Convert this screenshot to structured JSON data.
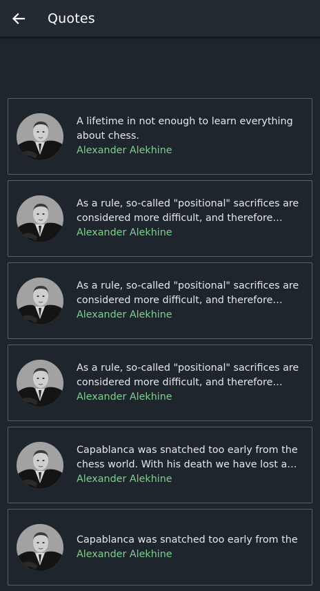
{
  "app_bar": {
    "back_icon": "arrow-left-icon",
    "title": "Quotes"
  },
  "colors": {
    "background": "#1f252c",
    "app_bar": "#232a31",
    "author": "#7fcf8f",
    "card_border": "#5c6166",
    "text": "#e6e8ea"
  },
  "quotes": [
    {
      "text": "A lifetime in not enough to learn everything about chess.",
      "author": "Alexander Alekhine"
    },
    {
      "text": "As a rule, so-called \"positional\" sacrifices are considered more difficult, and therefore more…",
      "author": "Alexander Alekhine"
    },
    {
      "text": "As a rule, so-called \"positional\" sacrifices are considered more difficult, and therefore more…",
      "author": "Alexander Alekhine"
    },
    {
      "text": "As a rule, so-called \"positional\" sacrifices are considered more difficult, and therefore more…",
      "author": "Alexander Alekhine"
    },
    {
      "text": "Capablanca was snatched too early from the chess world. With his death we have lost a great…",
      "author": "Alexander Alekhine"
    },
    {
      "text": "Capablanca was snatched too early from the",
      "author": "Alexander Alekhine"
    }
  ]
}
